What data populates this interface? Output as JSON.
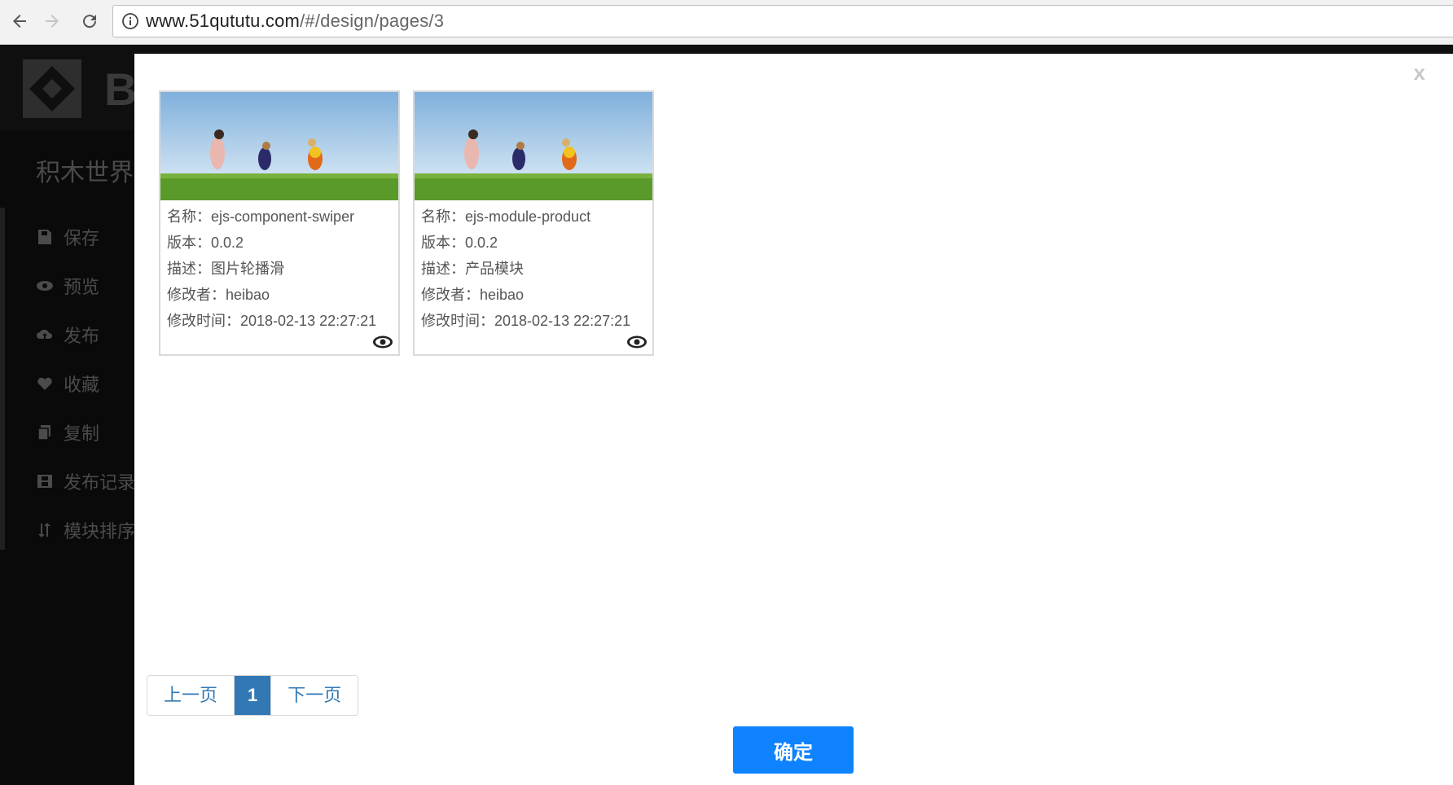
{
  "browser": {
    "url_host": "www.51qututu.com",
    "url_path": "/#/design/pages/3"
  },
  "app": {
    "logo_letter": "B",
    "site_name": "积木世界",
    "menu": [
      {
        "label": "保存",
        "icon": "save-icon"
      },
      {
        "label": "预览",
        "icon": "eye-icon"
      },
      {
        "label": "发布",
        "icon": "cloud-upload-icon"
      },
      {
        "label": "收藏",
        "icon": "heart-icon"
      },
      {
        "label": "复制",
        "icon": "copy-icon"
      },
      {
        "label": "发布记录",
        "icon": "film-icon"
      },
      {
        "label": "模块排序",
        "icon": "sort-icon"
      }
    ]
  },
  "modal": {
    "close_label": "x",
    "cards": [
      {
        "name": "名称：ejs-component-swiper",
        "version": "版本：0.0.2",
        "description": "描述：图片轮播滑",
        "modifier": "修改者：heibao",
        "modified_time": "修改时间：2018-02-13 22:27:21"
      },
      {
        "name": "名称：ejs-module-product",
        "version": "版本：0.0.2",
        "description": "描述：产品模块",
        "modifier": "修改者：heibao",
        "modified_time": "修改时间：2018-02-13 22:27:21"
      }
    ],
    "pagination": {
      "prev": "上一页",
      "current": "1",
      "next": "下一页"
    },
    "confirm_label": "确定"
  },
  "colors": {
    "primary": "#0f82ff",
    "pagination_active": "#3278b5"
  }
}
